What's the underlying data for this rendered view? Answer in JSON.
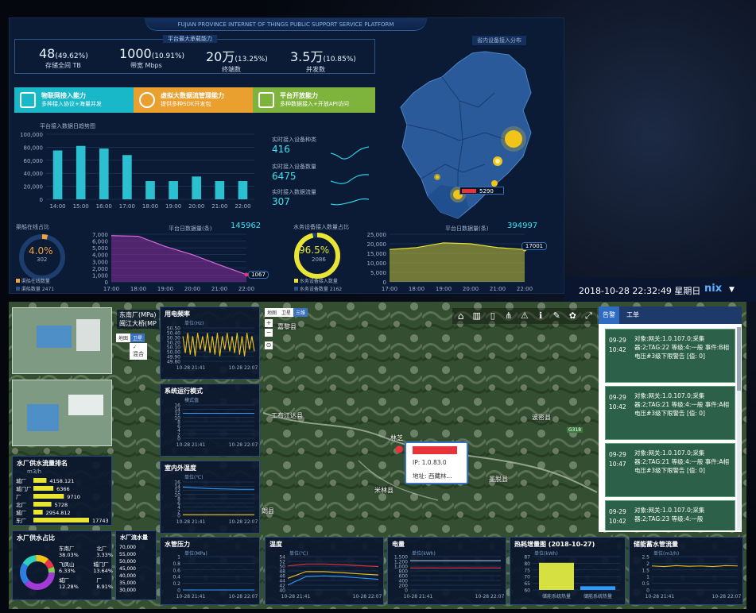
{
  "platform": {
    "title_en": "FUJIAN PROVINCE INTERNET OF THINGS PUBLIC SUPPORT SERVICE PLATFORM",
    "stats_title": "平台最大承载能力",
    "map_title": "省内设备接入分布",
    "stats": [
      {
        "value": "48",
        "pct": "(49.62%)",
        "label": "存储全间 TB"
      },
      {
        "value": "1000",
        "pct": "(10.91%)",
        "label": "带宽 Mbps"
      },
      {
        "value": "20万",
        "pct": "(13.25%)",
        "label": "终端数"
      },
      {
        "value": "3.5万",
        "pct": "(10.85%)",
        "label": "并发数"
      }
    ],
    "capabilities": [
      {
        "title": "物联网接入能力",
        "desc": "多种接入协议+海量并发",
        "color": "#18b8c9"
      },
      {
        "title": "虚拟大数据流管理能力",
        "desc": "提供多种SDK开发包",
        "color": "#e9a02f"
      },
      {
        "title": "平台开放能力",
        "desc": "多种数据接入+开放API访问",
        "color": "#7fb43c"
      }
    ],
    "realtime": [
      {
        "label": "实时接入设备种类",
        "value": "416"
      },
      {
        "label": "实时接入设备数量",
        "value": "6475"
      },
      {
        "label": "实时接入数据流量",
        "value": "307"
      }
    ],
    "map_badge": "5290",
    "online_rate": {
      "title": "渠船在线占比",
      "pct": "4.0%",
      "sub": "302",
      "legend1": "渠船在线数量",
      "legend2": "渠船数量 2471"
    },
    "water_rate": {
      "title": "水务设备接入数量占比",
      "pct": "96.5%",
      "sub": "2086",
      "legend1": "水务设备接入数量",
      "legend2": "水务设备数量 2162"
    },
    "daily_chart_title": "平台日数据量(条)",
    "daily_chart_total": "145962",
    "daily_chart_end": "1067",
    "water_chart_title": "平台日数据量(条)",
    "water_chart_total": "394997",
    "water_chart_end": "17001"
  },
  "chart_data": [
    {
      "type": "bar",
      "title": "平台接入数据日趋势图",
      "categories": [
        "14:00",
        "15:00",
        "16:00",
        "17:00",
        "18:00",
        "19:00",
        "20:00",
        "21:00",
        "22:00"
      ],
      "values": [
        75000,
        82000,
        78000,
        68000,
        28000,
        28000,
        35000,
        28000,
        28000
      ],
      "ylim": [
        0,
        100000
      ],
      "yticks": [
        "100,000",
        "80,000",
        "60,000",
        "40,000",
        "20,000",
        "0"
      ]
    },
    {
      "type": "area",
      "title": "平台日数据量(条)",
      "categories": [
        "17:00",
        "18:00",
        "19:00",
        "20:00",
        "21:00",
        "22:00"
      ],
      "values": [
        6800,
        6700,
        5200,
        4000,
        2500,
        1067
      ],
      "ylim": [
        0,
        7000
      ],
      "yticks": [
        "7,000",
        "6,000",
        "5,000",
        "4,000",
        "3,000",
        "2,000",
        "1,000",
        "0"
      ]
    },
    {
      "type": "area",
      "title": "平台日数据量(条)",
      "categories": [
        "17:00",
        "18:00",
        "19:00",
        "20:00",
        "21:00",
        "22:00"
      ],
      "values": [
        17000,
        18000,
        20500,
        20000,
        18000,
        17001
      ],
      "ylim": [
        0,
        25000
      ],
      "yticks": [
        "25,000",
        "20,000",
        "15,000",
        "10,000",
        "5,000",
        "0"
      ]
    },
    {
      "type": "bar",
      "title": "水厂供水流量排名",
      "unit": "m3/h",
      "categories": [
        "城厂",
        "城门厂",
        "厂",
        "北厂",
        "城厂",
        "东厂"
      ],
      "values": [
        4158.121,
        6366,
        9710,
        5728,
        2954.812,
        17743
      ],
      "labels": [
        "4158.121",
        "6366",
        "9710",
        "5728",
        "2954.812",
        "17743"
      ]
    },
    {
      "type": "bar",
      "title": "热耗增量图 (2018-10-27)",
      "unit": "单位(kWh)",
      "categories": [
        "储能系统热量",
        "储能系统热量"
      ],
      "values": [
        82,
        63
      ],
      "ylim": [
        60,
        87
      ],
      "yticks": [
        "87",
        "80",
        "75",
        "70",
        "65",
        "60"
      ]
    }
  ],
  "datetime": "2018-10-28 22:32:49 星期日",
  "user": "nix",
  "bottom": {
    "station_title": "东南厂(MPa)",
    "station_sub": "闽江大桥(MP",
    "map_tabs": [
      "地图",
      "卫星",
      "三维"
    ],
    "left_map_tabs": [
      "地图",
      "卫星"
    ],
    "legend_mixed": "混合",
    "flow_rank_title": "水厂供水流量排名",
    "flow_unit": "m3/h",
    "pie_title": "水厂供水占比",
    "pie_labels": [
      {
        "name": "东南厂",
        "pct": "38.03%"
      },
      {
        "name": "北厂",
        "pct": "3.33%"
      },
      {
        "name": "飞凤山",
        "pct": "6.33%"
      },
      {
        "name": "城门厂",
        "pct": "13.64%"
      },
      {
        "name": "城厂",
        "pct": "12.28%"
      },
      {
        "name": "厂",
        "pct": "8.91%"
      }
    ],
    "level_title": "水厂流水量",
    "level_ticks": [
      "70,000",
      "55,000",
      "50,000",
      "45,000",
      "40,000",
      "35,000",
      "30,000"
    ],
    "alarm_tabs": [
      "告警",
      "工单"
    ],
    "alarms": [
      {
        "date": "09-29",
        "time": "10:42",
        "text": "对象:网关:1.0.107.0;采集器:2;TAG:22 等级:4:一般 事件:B相电压#3级下限警告 [值: 0]"
      },
      {
        "date": "09-29",
        "time": "10:42",
        "text": "对象:网关:1.0.107.0;采集器:2;TAG:21 等级:4:一般 事件:A相电压#3级下限警告 [值: 0]"
      },
      {
        "date": "09-29",
        "time": "10:47",
        "text": "对象:网关:1.0.107.0;采集器:2;TAG:21 等级:4:一般 事件:A相电压#3级下限警告 [值: 0]"
      },
      {
        "date": "09-29",
        "time": "10:42",
        "text": "对象:网关:1.0.107.0;采集器:2;TAG:23 等级:4:一般"
      }
    ],
    "map_labels": [
      {
        "text": "工布江达县"
      },
      {
        "text": "林芝"
      },
      {
        "text": "波密县"
      },
      {
        "text": "米林县"
      },
      {
        "text": "墨脱县"
      },
      {
        "text": "朗县"
      },
      {
        "text": "嘉黎县"
      },
      {
        "text": "G318"
      }
    ],
    "popup": {
      "ip": "IP: 1.0.83.0",
      "addr": "地址: 西藏林..."
    },
    "panels": {
      "freq": {
        "title": "用电频率",
        "unit": "单位(Hz)",
        "yticks": [
          "50.50",
          "50.40",
          "50.30",
          "50.20",
          "50.10",
          "50.00",
          "49.90",
          "49.80"
        ],
        "xticks": [
          "10-28 21:41",
          "10-28 22:07"
        ]
      },
      "mode": {
        "title": "系统运行模式",
        "unit": "模式值",
        "yticks": [
          "16",
          "14",
          "12",
          "10",
          "8",
          "6",
          "4",
          "2",
          "0"
        ],
        "xticks": [
          "10-28 21:41",
          "10-28 22:07"
        ]
      },
      "indoor": {
        "title": "室内外温度",
        "unit": "单位(℃)",
        "yticks": [
          "16",
          "14",
          "12",
          "10",
          "8",
          "6",
          "4",
          "2",
          "0"
        ],
        "xticks": [
          "10-28 21:41",
          "10-28 22:07"
        ]
      },
      "pressure": {
        "title": "水管压力",
        "unit": "单位(MPa)",
        "yticks": [
          "1",
          "0.8",
          "0.6",
          "0.4",
          "0.2",
          "0"
        ],
        "xticks": [
          "10-28 21:41",
          "10-28 22:07"
        ]
      },
      "temp": {
        "title": "温度",
        "unit": "单位(℃)",
        "yticks": [
          "54",
          "52",
          "50",
          "48",
          "46",
          "44",
          "42",
          "40"
        ],
        "xticks": [
          "10-28 21:41",
          "10-28 22:07"
        ]
      },
      "power": {
        "title": "电量",
        "unit": "单位(kWh)",
        "yticks": [
          "1,500",
          "1,200",
          "1,000",
          "800",
          "600",
          "400",
          "200",
          "0"
        ],
        "xticks": [
          "10-28 21:41",
          "10-28 22:07"
        ]
      },
      "heat": {
        "title": "热耗增量图 (2018-10-27)",
        "unit": "单位(kWh)",
        "xlabels": [
          "储能系统热量",
          "储能系统热量"
        ]
      },
      "storage": {
        "title": "储能蓄水管流量",
        "unit": "单位(m3/h)",
        "yticks": [
          "2.5",
          "2",
          "1.5",
          "1",
          "0.5",
          "0"
        ],
        "xticks": [
          "10-28 21:41",
          "10-28 22:07"
        ]
      }
    }
  }
}
